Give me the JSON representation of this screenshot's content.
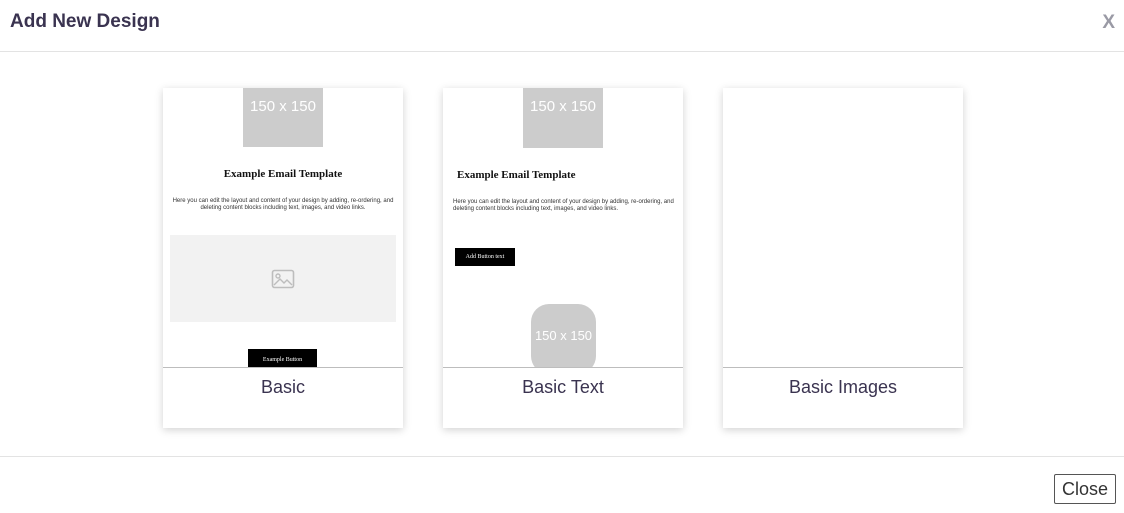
{
  "dialog": {
    "title": "Add New Design",
    "close_x": "X"
  },
  "templates": [
    {
      "label": "Basic",
      "preview": {
        "placeholder_top": "150 x 150",
        "heading": "Example Email Template",
        "body": "Here you can edit the layout and content of your design by adding, re-ordering, and deleting content blocks including text, images, and video links.",
        "image_icon": "image-icon",
        "button": "Example Button"
      }
    },
    {
      "label": "Basic Text",
      "preview": {
        "placeholder_top": "150 x 150",
        "heading": "Example Email Template",
        "body": "Here you can edit the layout and content of your design by adding, re-ordering, and deleting content blocks including text, images, and video links.",
        "button": "Add Button text",
        "placeholder_bottom": "150 x 150"
      }
    },
    {
      "label": "Basic Images",
      "preview": {}
    }
  ],
  "footer": {
    "close_label": "Close"
  }
}
